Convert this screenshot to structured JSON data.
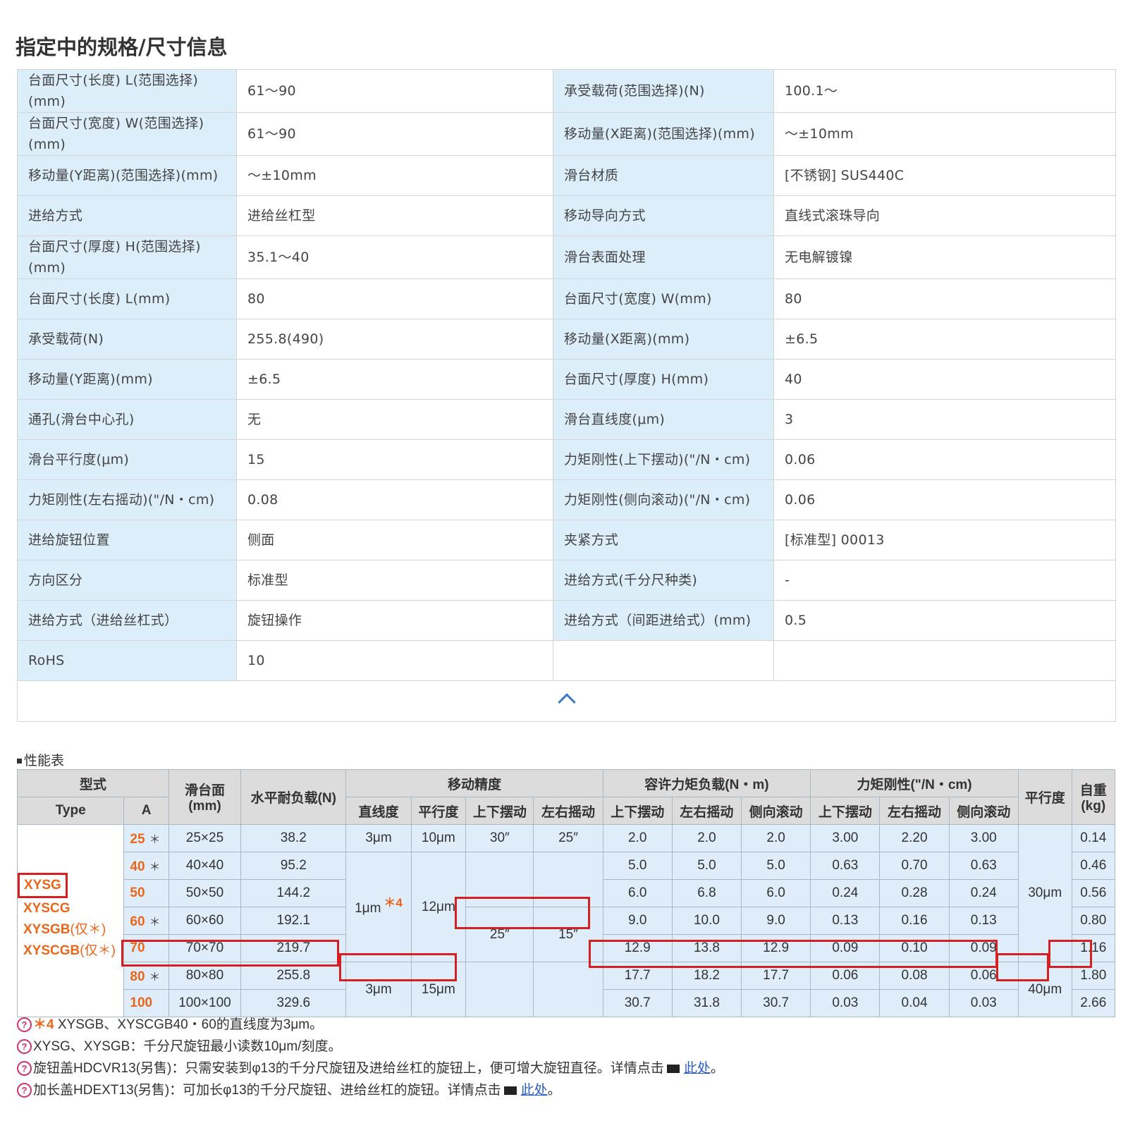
{
  "page_title": "指定中的规格/尺寸信息",
  "spec_rows": [
    {
      "l1": "台面尺寸(长度) L(范围选择)(mm)",
      "v1": "61～90",
      "l2": "承受载荷(范围选择)(N)",
      "v2": "100.1～"
    },
    {
      "l1": "台面尺寸(宽度) W(范围选择)(mm)",
      "v1": "61～90",
      "l2": "移动量(X距离)(范围选择)(mm)",
      "v2": "～±10mm"
    },
    {
      "l1": "移动量(Y距离)(范围选择)(mm)",
      "v1": "～±10mm",
      "l2": "滑台材质",
      "v2": "[不锈钢] SUS440C"
    },
    {
      "l1": "进给方式",
      "v1": "进给丝杠型",
      "l2": "移动导向方式",
      "v2": "直线式滚珠导向"
    },
    {
      "l1": "台面尺寸(厚度) H(范围选择)(mm)",
      "v1": "35.1～40",
      "l2": "滑台表面处理",
      "v2": "无电解镀镍"
    },
    {
      "l1": "台面尺寸(长度) L(mm)",
      "v1": "80",
      "l2": "台面尺寸(宽度) W(mm)",
      "v2": "80"
    },
    {
      "l1": "承受载荷(N)",
      "v1": "255.8(490)",
      "l2": "移动量(X距离)(mm)",
      "v2": "±6.5"
    },
    {
      "l1": "移动量(Y距离)(mm)",
      "v1": "±6.5",
      "l2": "台面尺寸(厚度) H(mm)",
      "v2": "40"
    },
    {
      "l1": "通孔(滑台中心孔)",
      "v1": "无",
      "l2": "滑台直线度(μm)",
      "v2": "3"
    },
    {
      "l1": "滑台平行度(μm)",
      "v1": "15",
      "l2": "力矩刚性(上下摆动)(\"/N・cm)",
      "v2": "0.06"
    },
    {
      "l1": "力矩刚性(左右摇动)(\"/N・cm)",
      "v1": "0.08",
      "l2": "力矩刚性(侧向滚动)(\"/N・cm)",
      "v2": "0.06"
    },
    {
      "l1": "进给旋钮位置",
      "v1": "侧面",
      "l2": "夹紧方式",
      "v2": "[标准型] 00013"
    },
    {
      "l1": "方向区分",
      "v1": "标准型",
      "l2": "进给方式(千分尺种类)",
      "v2": "-"
    },
    {
      "l1": "进给方式（进给丝杠式）",
      "v1": "旋钮操作",
      "l2": "进给方式（间距进给式）(mm)",
      "v2": "0.5"
    },
    {
      "l1": "RoHS",
      "v1": "10",
      "l2": "",
      "v2": ""
    }
  ],
  "perf": {
    "title": "性能表",
    "h": {
      "model": "型式",
      "type": "Type",
      "a": "A",
      "table_face": "滑台面",
      "mm": "(mm)",
      "load": "水平耐负载(N)",
      "accuracy": "移动精度",
      "straightness": "直线度",
      "parallelism": "平行度",
      "pitch": "上下摆动",
      "yaw": "左右摇动",
      "moment": "容许力矩负载(N・m)",
      "m_pitch": "上下摆动",
      "m_yaw": "左右摇动",
      "m_roll": "侧向滚动",
      "rigidity": "力矩刚性(\"/N・cm)",
      "r_pitch": "上下摆动",
      "r_yaw": "左右摇动",
      "r_roll": "侧向滚动",
      "parallel2": "平行度",
      "weight": "自重",
      "kg": "(kg)"
    },
    "types": [
      {
        "name": "XYSG",
        "note": ""
      },
      {
        "name": "XYSCG",
        "note": ""
      },
      {
        "name": "XYSGB",
        "note": "(仅＊)"
      },
      {
        "name": "XYSCGB",
        "note": "(仅＊)"
      }
    ],
    "rows": [
      {
        "a": "25",
        "star": "＊",
        "face": "25×25",
        "load": "38.2",
        "mp": "2.0",
        "my": "2.0",
        "mr": "2.0",
        "rp": "3.00",
        "ry": "2.20",
        "rr": "3.00",
        "w": "0.14"
      },
      {
        "a": "40",
        "star": "＊",
        "face": "40×40",
        "load": "95.2",
        "mp": "5.0",
        "my": "5.0",
        "mr": "5.0",
        "rp": "0.63",
        "ry": "0.70",
        "rr": "0.63",
        "w": "0.46"
      },
      {
        "a": "50",
        "star": "",
        "face": "50×50",
        "load": "144.2",
        "mp": "6.0",
        "my": "6.8",
        "mr": "6.0",
        "rp": "0.24",
        "ry": "0.28",
        "rr": "0.24",
        "w": "0.56"
      },
      {
        "a": "60",
        "star": "＊",
        "face": "60×60",
        "load": "192.1",
        "mp": "9.0",
        "my": "10.0",
        "mr": "9.0",
        "rp": "0.13",
        "ry": "0.16",
        "rr": "0.13",
        "w": "0.80"
      },
      {
        "a": "70",
        "star": "",
        "face": "70×70",
        "load": "219.7",
        "mp": "12.9",
        "my": "13.8",
        "mr": "12.9",
        "rp": "0.09",
        "ry": "0.10",
        "rr": "0.09",
        "w": "1.16"
      },
      {
        "a": "80",
        "star": "＊",
        "face": "80×80",
        "load": "255.8",
        "mp": "17.7",
        "my": "18.2",
        "mr": "17.7",
        "rp": "0.06",
        "ry": "0.08",
        "rr": "0.06",
        "w": "1.80"
      },
      {
        "a": "100",
        "star": "",
        "face": "100×100",
        "load": "329.6",
        "mp": "30.7",
        "my": "31.8",
        "mr": "30.7",
        "rp": "0.03",
        "ry": "0.04",
        "rr": "0.03",
        "w": "2.66"
      }
    ],
    "acc": {
      "st_25": "3μm",
      "pa_25": "10μm",
      "pi_25": "30″",
      "ya_25": "25″",
      "st_mid": "1μm",
      "st_mid_sup": "＊4",
      "pa_mid": "12μm",
      "pi_mid": "25″",
      "ya_mid": "15″",
      "st_big": "3μm",
      "pa_big": "15μm",
      "par_small": "30μm",
      "par_big": "40μm"
    }
  },
  "notes": [
    {
      "icon": "?",
      "sup": "＊4",
      "text": " XYSGB、XYSCGB40・60的直线度为3μm。",
      "link": ""
    },
    {
      "icon": "?",
      "sup": "",
      "text": "XYSG、XYSGB：千分尺旋钮最小读数10μm/刻度。",
      "link": ""
    },
    {
      "icon": "?",
      "sup": "",
      "text": "旋钮盖HDCVR13(另售)：只需安装到φ13的千分尺旋钮及进给丝杠的旋钮上，便可增大旋钮直径。详情点击",
      "link": "此处"
    },
    {
      "icon": "?",
      "sup": "",
      "text": "加长盖HDEXT13(另售)：可加长φ13的千分尺旋钮、进给丝杠的旋钮。详情点击",
      "link": "此处"
    }
  ]
}
